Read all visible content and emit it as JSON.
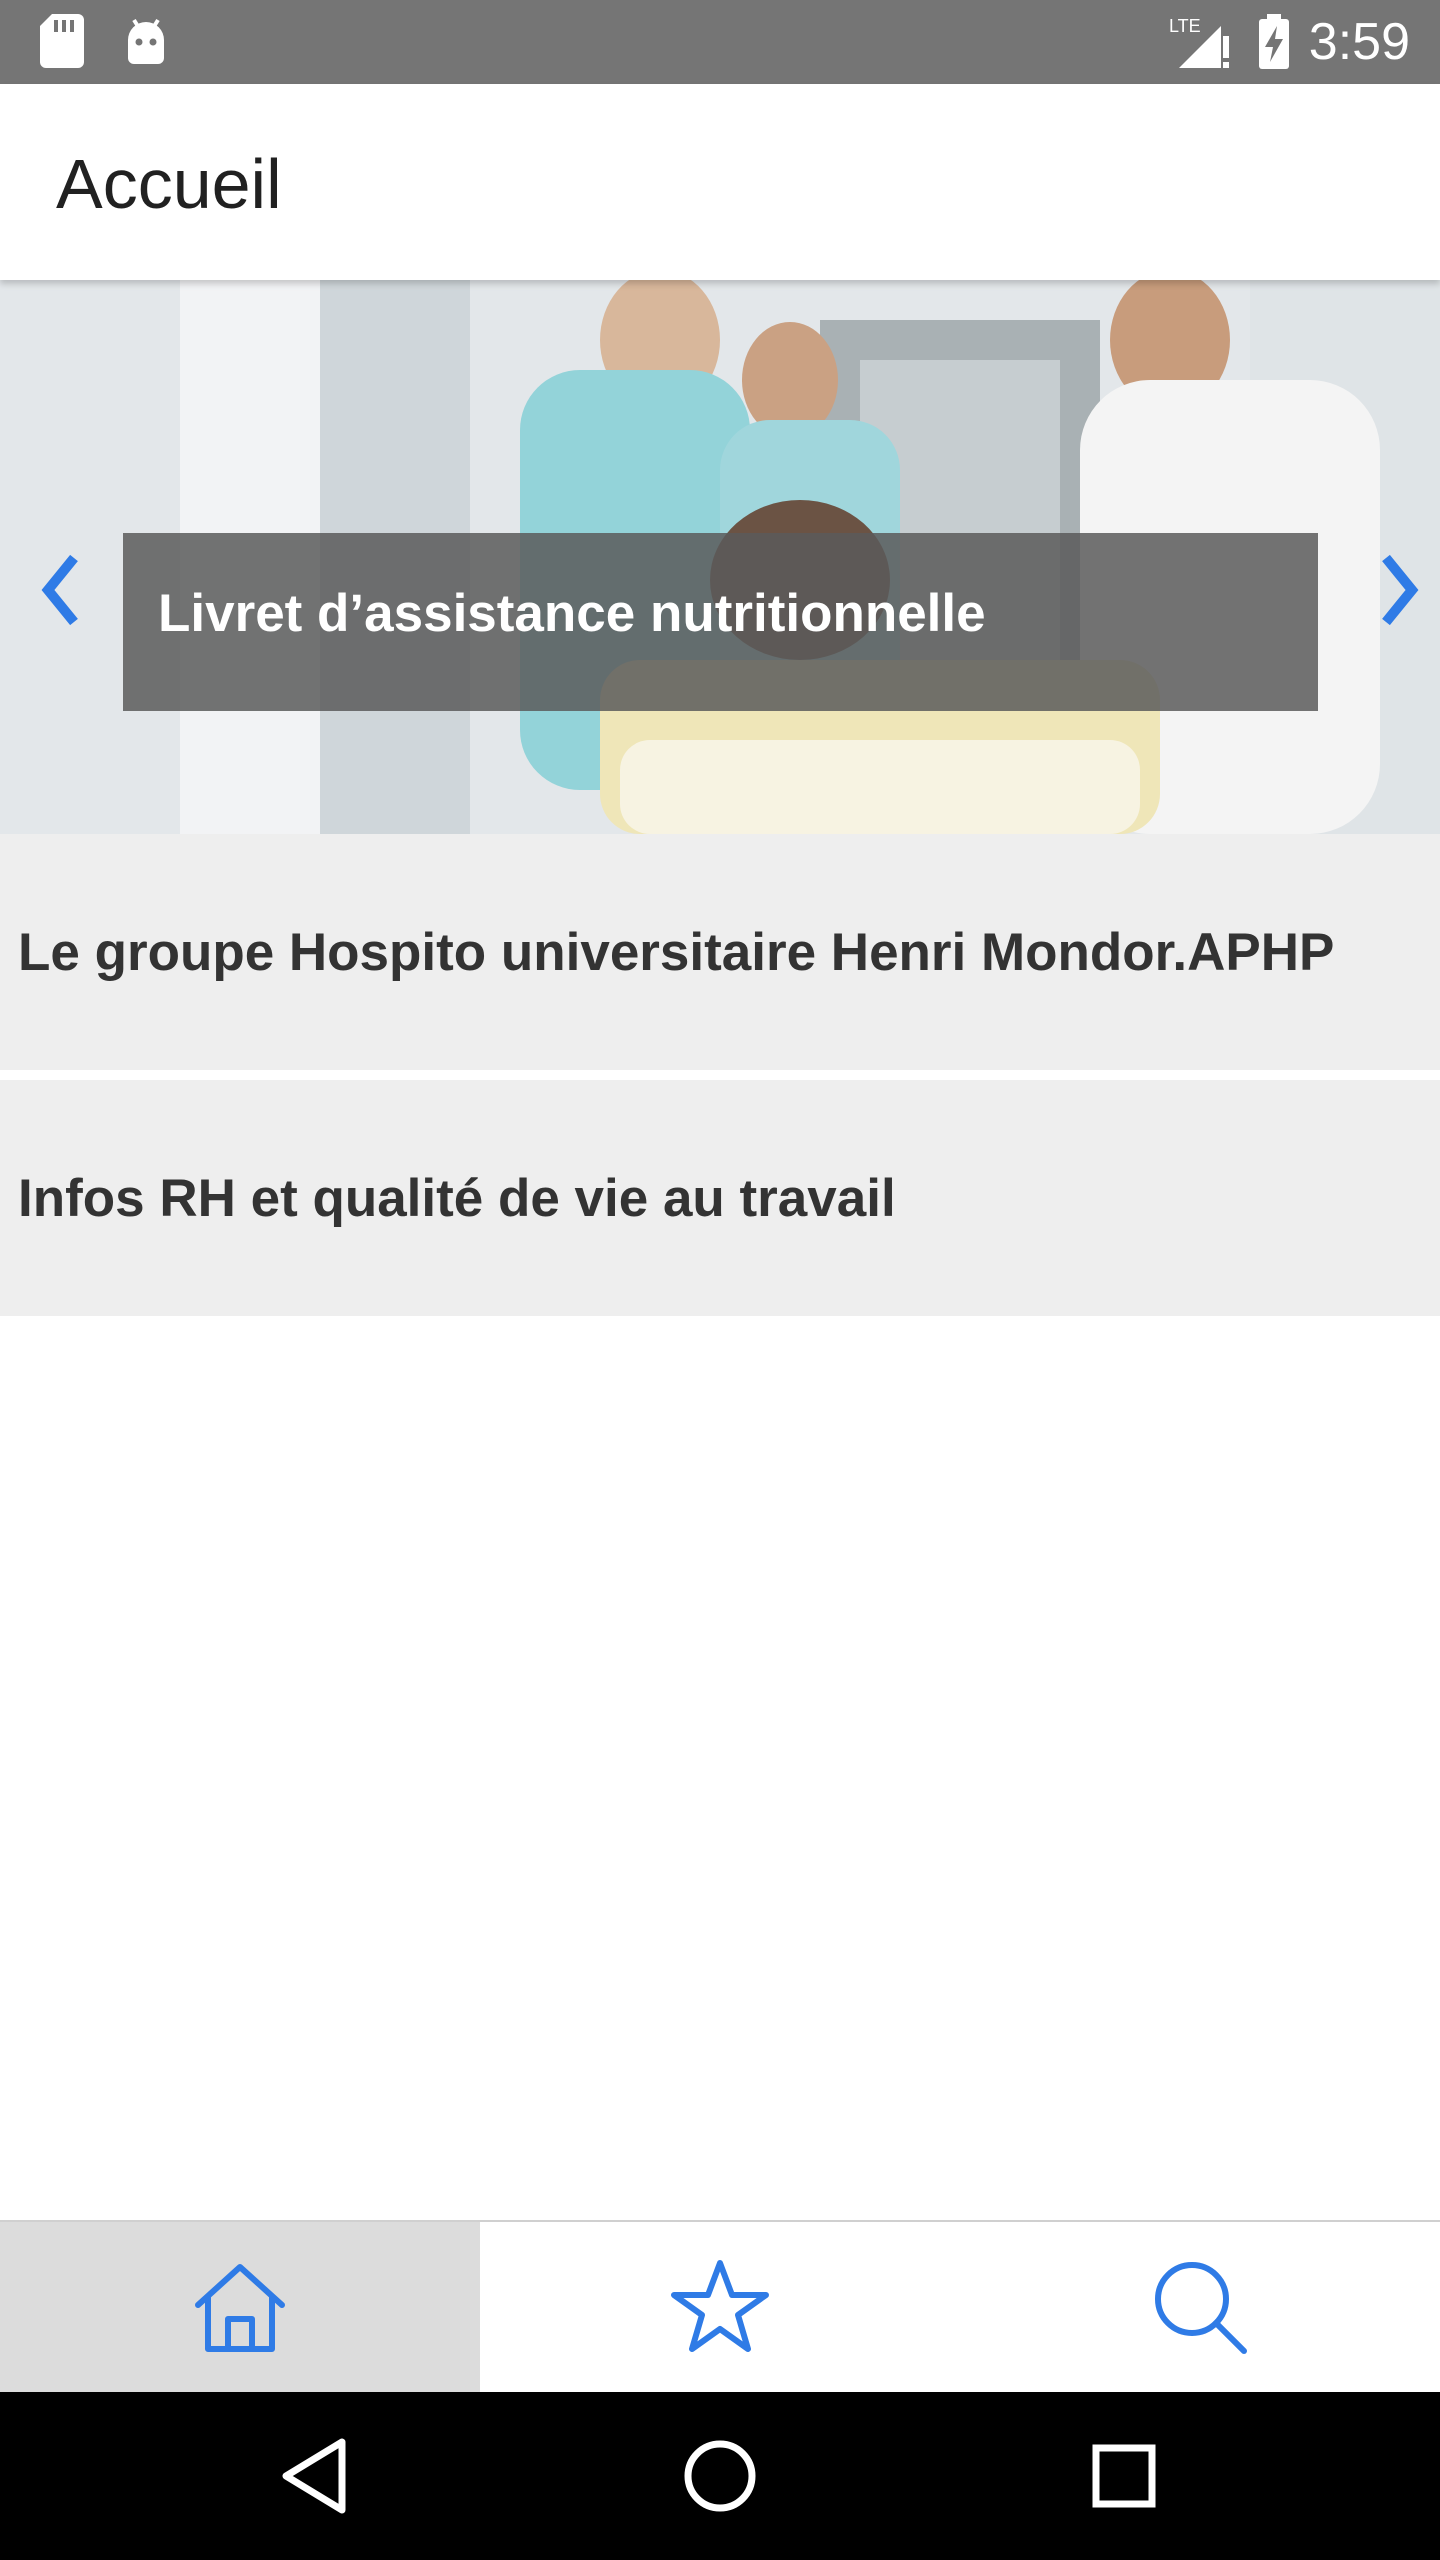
{
  "status_bar": {
    "time": "3:59",
    "network": "LTE",
    "icons": [
      "sd-card-icon",
      "android-icon",
      "signal-icon",
      "battery-charging-icon"
    ]
  },
  "app_bar": {
    "title": "Accueil"
  },
  "carousel": {
    "caption": "Livret d’assistance nutritionnelle",
    "prev_icon": "chevron-left-icon",
    "next_icon": "chevron-right-icon"
  },
  "list": {
    "items": [
      {
        "label": "Le groupe Hospito universitaire Henri Mondor.APHP"
      },
      {
        "label": "Infos RH et qualité de vie au travail"
      }
    ]
  },
  "bottom_nav": {
    "tabs": [
      {
        "icon": "home-icon",
        "active": true
      },
      {
        "icon": "star-icon",
        "active": false
      },
      {
        "icon": "search-icon",
        "active": false
      }
    ]
  },
  "colors": {
    "accent": "#2f7be6",
    "status_bar": "#757575",
    "list_bg": "#eeeeee",
    "caption_bg": "#5a5a5a"
  }
}
